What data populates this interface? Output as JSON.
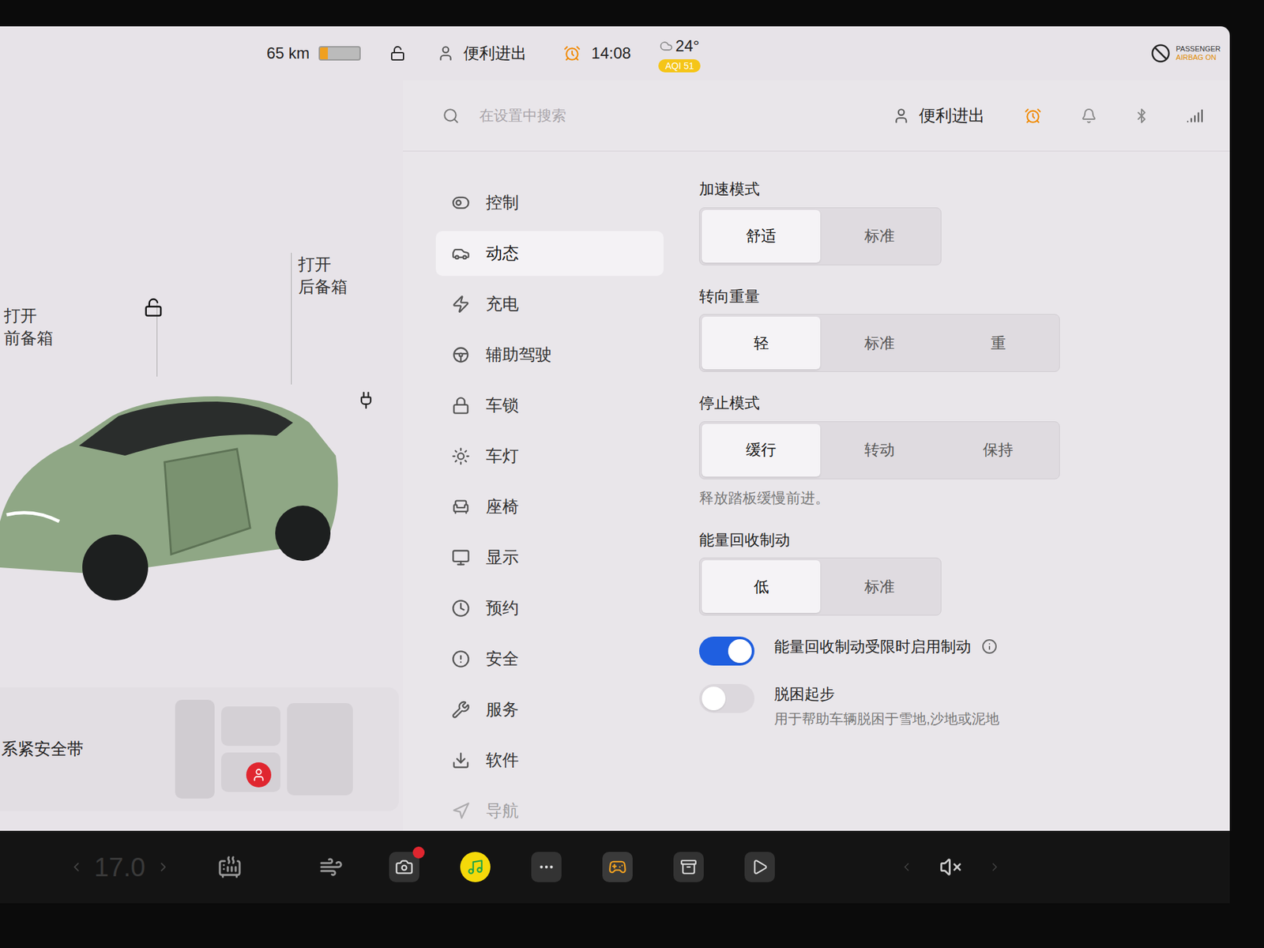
{
  "status_bar": {
    "range": "65 km",
    "battery_level": 0.2,
    "locked": false,
    "profile": "便利进出",
    "time": "14:08",
    "temperature": "24°",
    "aqi": "AQI 51",
    "airbag": [
      "PASSENGER",
      "AIRBAG ON"
    ]
  },
  "car_view": {
    "frunk": {
      "action": "打开",
      "label": "前备箱"
    },
    "trunk": {
      "action": "打开",
      "label": "后备箱"
    },
    "seatbelt_alert": "系紧安全带"
  },
  "settings": {
    "search_placeholder": "在设置中搜索",
    "profile": "便利进出"
  },
  "sidebar": {
    "items": [
      {
        "label": "控制",
        "selected": false
      },
      {
        "label": "动态",
        "selected": true
      },
      {
        "label": "充电",
        "selected": false
      },
      {
        "label": "辅助驾驶",
        "selected": false
      },
      {
        "label": "车锁",
        "selected": false
      },
      {
        "label": "车灯",
        "selected": false
      },
      {
        "label": "座椅",
        "selected": false
      },
      {
        "label": "显示",
        "selected": false
      },
      {
        "label": "预约",
        "selected": false
      },
      {
        "label": "安全",
        "selected": false
      },
      {
        "label": "服务",
        "selected": false
      },
      {
        "label": "软件",
        "selected": false
      },
      {
        "label": "导航",
        "selected": false
      }
    ]
  },
  "sections": [
    {
      "title": "加速模式",
      "options": [
        {
          "label": "舒适",
          "selected": true
        },
        {
          "label": "标准",
          "selected": false
        }
      ]
    },
    {
      "title": "转向重量",
      "options": [
        {
          "label": "轻",
          "selected": true
        },
        {
          "label": "标准",
          "selected": false
        },
        {
          "label": "重",
          "selected": false
        }
      ]
    },
    {
      "title": "停止模式",
      "options": [
        {
          "label": "缓行",
          "selected": true
        },
        {
          "label": "转动",
          "selected": false
        },
        {
          "label": "保持",
          "selected": false
        }
      ],
      "description": "释放踏板缓慢前进。"
    },
    {
      "title": "能量回收制动",
      "options": [
        {
          "label": "低",
          "selected": true
        },
        {
          "label": "标准",
          "selected": false
        }
      ]
    }
  ],
  "toggles": [
    {
      "label": "能量回收制动受限时启用制动",
      "on": true,
      "info": true,
      "subtitle": ""
    },
    {
      "label": "脱困起步",
      "on": false,
      "info": false,
      "subtitle": "用于帮助车辆脱困于雪地,沙地或泥地"
    }
  ],
  "dock": {
    "temperature": "17.0",
    "camera_alert": true,
    "volume_muted": true
  }
}
